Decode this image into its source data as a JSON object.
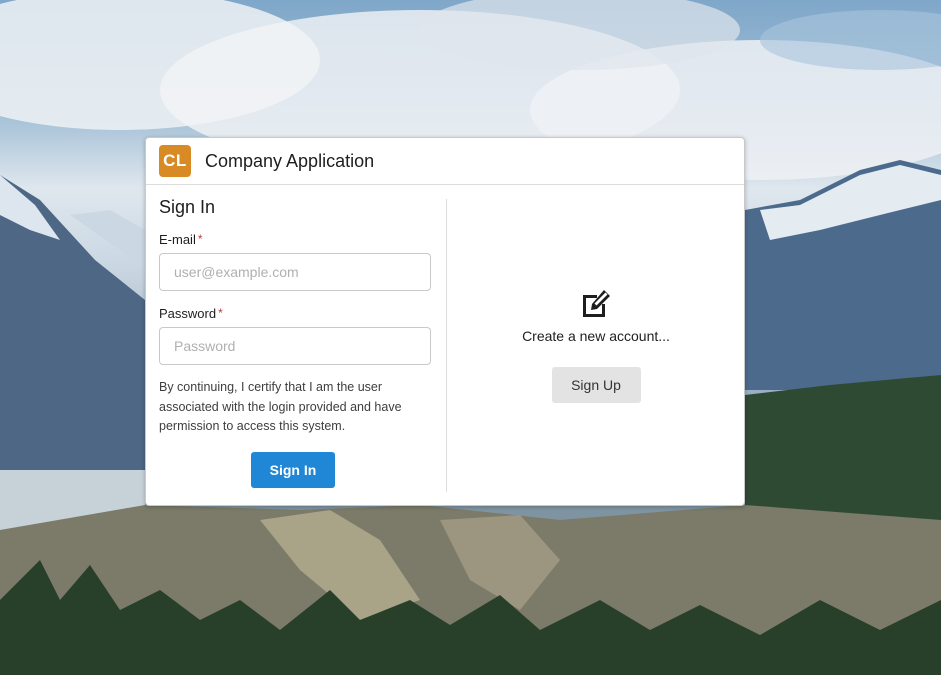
{
  "app": {
    "logo_text": "CL",
    "title": "Company Application"
  },
  "signin": {
    "heading": "Sign In",
    "email_label": "E-mail",
    "email_placeholder": "user@example.com",
    "password_label": "Password",
    "password_placeholder": "Password",
    "required_marker": "*",
    "disclaimer": "By continuing, I certify that I am the user associated with the login provided and have permission to access this system.",
    "button_label": "Sign In"
  },
  "signup": {
    "icon": "edit-icon",
    "prompt": "Create a new account...",
    "button_label": "Sign Up"
  },
  "colors": {
    "logo_bg": "#d88a24",
    "primary_button": "#1f87d6",
    "secondary_button": "#e3e3e3",
    "required": "#c23934"
  }
}
